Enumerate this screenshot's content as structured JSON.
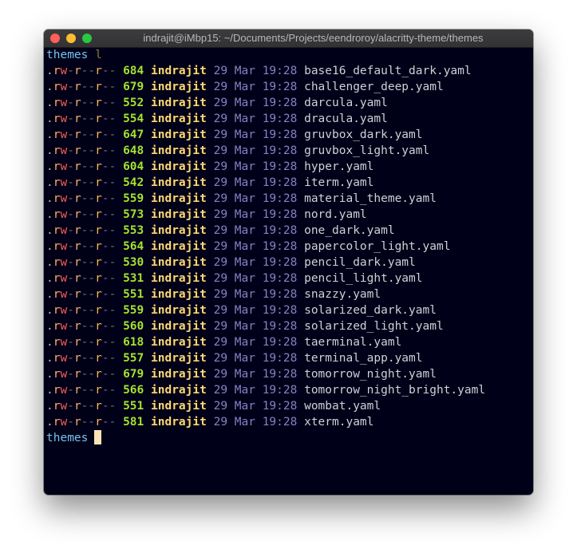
{
  "window": {
    "title": "indrajit@iMbp15: ~/Documents/Projects/eendroroy/alacritty-theme/themes"
  },
  "colors": {
    "background": "#000018",
    "prompt_dir": "#76c4f0",
    "size": "#a6e22e",
    "user": "#ffd870",
    "date": "#8a7fc7",
    "filename": "#d0d0d8"
  },
  "terminal": {
    "prompt_dir": "themes",
    "command": "l",
    "listing": [
      {
        "perm": ".rw-r--r--",
        "size": "684",
        "user": "indrajit",
        "date": "29 Mar 19:28",
        "name": "base16_default_dark.yaml"
      },
      {
        "perm": ".rw-r--r--",
        "size": "679",
        "user": "indrajit",
        "date": "29 Mar 19:28",
        "name": "challenger_deep.yaml"
      },
      {
        "perm": ".rw-r--r--",
        "size": "552",
        "user": "indrajit",
        "date": "29 Mar 19:28",
        "name": "darcula.yaml"
      },
      {
        "perm": ".rw-r--r--",
        "size": "554",
        "user": "indrajit",
        "date": "29 Mar 19:28",
        "name": "dracula.yaml"
      },
      {
        "perm": ".rw-r--r--",
        "size": "647",
        "user": "indrajit",
        "date": "29 Mar 19:28",
        "name": "gruvbox_dark.yaml"
      },
      {
        "perm": ".rw-r--r--",
        "size": "648",
        "user": "indrajit",
        "date": "29 Mar 19:28",
        "name": "gruvbox_light.yaml"
      },
      {
        "perm": ".rw-r--r--",
        "size": "604",
        "user": "indrajit",
        "date": "29 Mar 19:28",
        "name": "hyper.yaml"
      },
      {
        "perm": ".rw-r--r--",
        "size": "542",
        "user": "indrajit",
        "date": "29 Mar 19:28",
        "name": "iterm.yaml"
      },
      {
        "perm": ".rw-r--r--",
        "size": "559",
        "user": "indrajit",
        "date": "29 Mar 19:28",
        "name": "material_theme.yaml"
      },
      {
        "perm": ".rw-r--r--",
        "size": "573",
        "user": "indrajit",
        "date": "29 Mar 19:28",
        "name": "nord.yaml"
      },
      {
        "perm": ".rw-r--r--",
        "size": "553",
        "user": "indrajit",
        "date": "29 Mar 19:28",
        "name": "one_dark.yaml"
      },
      {
        "perm": ".rw-r--r--",
        "size": "564",
        "user": "indrajit",
        "date": "29 Mar 19:28",
        "name": "papercolor_light.yaml"
      },
      {
        "perm": ".rw-r--r--",
        "size": "530",
        "user": "indrajit",
        "date": "29 Mar 19:28",
        "name": "pencil_dark.yaml"
      },
      {
        "perm": ".rw-r--r--",
        "size": "531",
        "user": "indrajit",
        "date": "29 Mar 19:28",
        "name": "pencil_light.yaml"
      },
      {
        "perm": ".rw-r--r--",
        "size": "551",
        "user": "indrajit",
        "date": "29 Mar 19:28",
        "name": "snazzy.yaml"
      },
      {
        "perm": ".rw-r--r--",
        "size": "559",
        "user": "indrajit",
        "date": "29 Mar 19:28",
        "name": "solarized_dark.yaml"
      },
      {
        "perm": ".rw-r--r--",
        "size": "560",
        "user": "indrajit",
        "date": "29 Mar 19:28",
        "name": "solarized_light.yaml"
      },
      {
        "perm": ".rw-r--r--",
        "size": "618",
        "user": "indrajit",
        "date": "29 Mar 19:28",
        "name": "taerminal.yaml"
      },
      {
        "perm": ".rw-r--r--",
        "size": "557",
        "user": "indrajit",
        "date": "29 Mar 19:28",
        "name": "terminal_app.yaml"
      },
      {
        "perm": ".rw-r--r--",
        "size": "679",
        "user": "indrajit",
        "date": "29 Mar 19:28",
        "name": "tomorrow_night.yaml"
      },
      {
        "perm": ".rw-r--r--",
        "size": "566",
        "user": "indrajit",
        "date": "29 Mar 19:28",
        "name": "tomorrow_night_bright.yaml"
      },
      {
        "perm": ".rw-r--r--",
        "size": "551",
        "user": "indrajit",
        "date": "29 Mar 19:28",
        "name": "wombat.yaml"
      },
      {
        "perm": ".rw-r--r--",
        "size": "581",
        "user": "indrajit",
        "date": "29 Mar 19:28",
        "name": "xterm.yaml"
      }
    ],
    "final_prompt_dir": "themes"
  }
}
